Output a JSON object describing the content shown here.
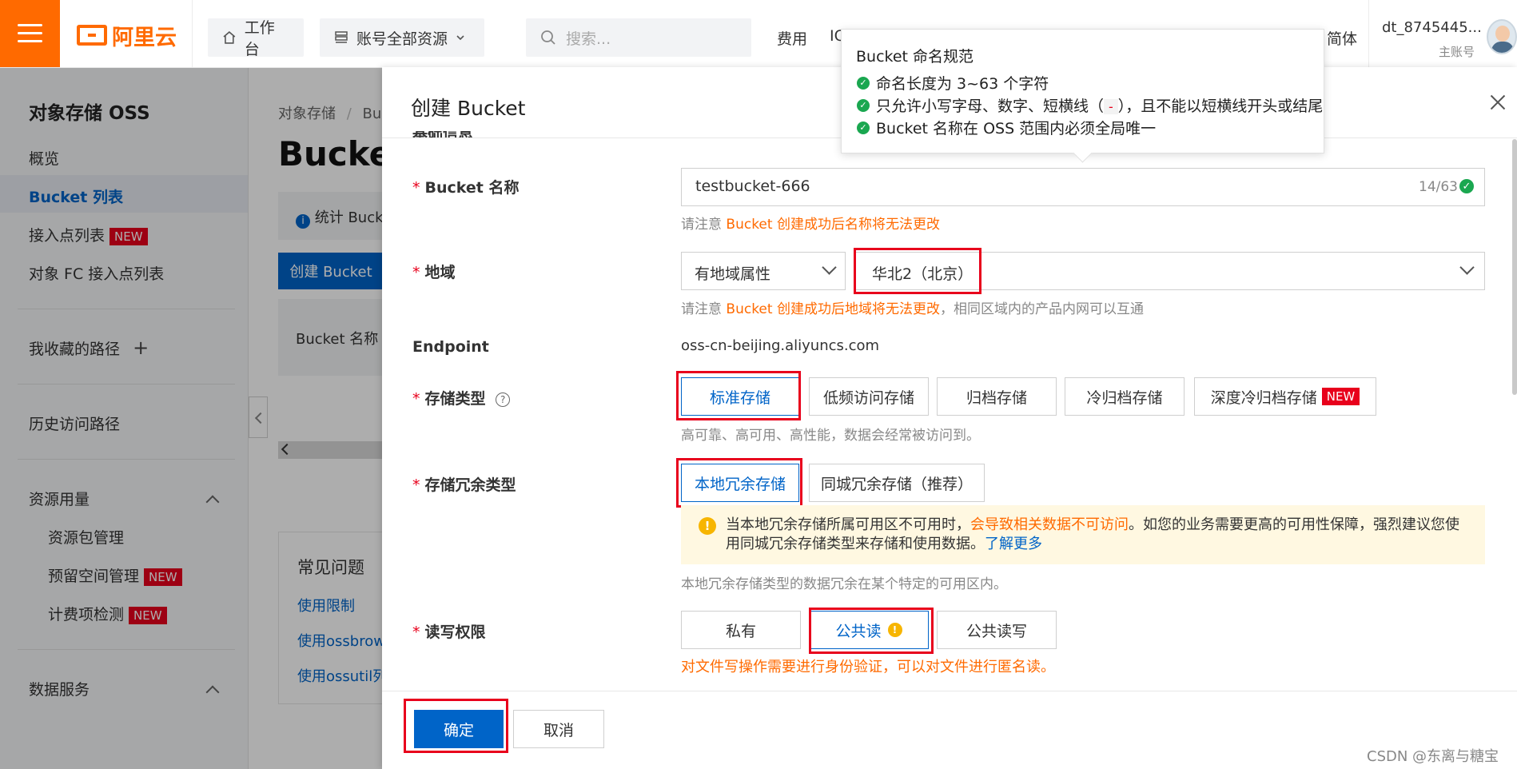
{
  "topbar": {
    "logo_text": "阿里云",
    "workbench": "工作台",
    "resources": "账号全部资源",
    "search_placeholder": "搜索...",
    "link_fee": "费用",
    "link_ic": "IC",
    "link_lang": "简体",
    "user_name": "dt_8745445...",
    "user_sub": "主账号"
  },
  "sidebar": {
    "title": "对象存储 OSS",
    "items": [
      "概览",
      "Bucket 列表",
      "接入点列表",
      "对象 FC 接入点列表",
      "我收藏的路径",
      "历史访问路径",
      "资源用量",
      "资源包管理",
      "预留空间管理",
      "计费项检测",
      "数据服务"
    ],
    "new_badge": "NEW",
    "add_icon": "+"
  },
  "background": {
    "breadcrumb_root": "对象存储",
    "breadcrumb_sep": "/",
    "breadcrumb_current": "Buc",
    "page_title": "Bucket",
    "info_text": "统计 Bucke",
    "create_button": "创建 Bucket",
    "col_bucket_name": "Bucket 名称",
    "faq_title": "常见问题",
    "faq_links": [
      "使用限制",
      "使用ossbrows",
      "使用ossutil列"
    ]
  },
  "drawer": {
    "title": "创建 Bucket",
    "section_partial": "基础信息",
    "labels": {
      "bucket_name": "Bucket 名称",
      "region": "地域",
      "endpoint": "Endpoint",
      "storage_class": "存储类型",
      "redundancy": "存储冗余类型",
      "acl": "读写权限"
    },
    "bucket_name_value": "testbucket-666",
    "bucket_name_counter": "14/63",
    "name_hint_prefix": "请注意",
    "name_hint_orange": "Bucket 创建成功后名称将无法更改",
    "region_attr": "有地域属性",
    "region_value": "华北2（北京）",
    "region_hint_prefix": "请注意",
    "region_hint_orange": "Bucket 创建成功后地域将无法更改",
    "region_hint_suffix": "，相同区域内的产品内网可以互通",
    "endpoint_value": "oss-cn-beijing.aliyuncs.com",
    "storage_options": [
      "标准存储",
      "低频访问存储",
      "归档存储",
      "冷归档存储",
      "深度冷归档存储"
    ],
    "storage_selected": "标准存储",
    "storage_hint": "高可靠、高可用、高性能，数据会经常被访问到。",
    "redundancy_options": [
      "本地冗余存储",
      "同城冗余存储（推荐）"
    ],
    "redundancy_selected": "本地冗余存储",
    "warn_part1": "当本地冗余存储所属可用区不可用时，",
    "warn_orange": "会导致相关数据不可访问",
    "warn_part2": "。如您的业务需要更高的可用性保障，强烈建议您使用同城冗余存储类型来存储和使用数据。",
    "warn_link": "了解更多",
    "redundancy_hint": "本地冗余存储类型的数据冗余在某个特定的可用区内。",
    "acl_options": [
      "私有",
      "公共读",
      "公共读写"
    ],
    "acl_selected": "公共读",
    "acl_warning": "对文件写操作需要进行身份验证，可以对文件进行匿名读。",
    "ok_button": "确定",
    "cancel_button": "取消"
  },
  "tooltip": {
    "title": "Bucket 命名规范",
    "rule1": "命名长度为 3~63 个字符",
    "rule2_a": "只允许小写字母、数字、短横线（",
    "rule2_dash": "-",
    "rule2_b": "），且不能以短横线开头或结尾",
    "rule3": "Bucket 名称在 OSS 范围内必须全局唯一"
  },
  "watermark": "CSDN @东离与糖宝",
  "colors": {
    "brand_orange": "#ff6a00",
    "primary_blue": "#0064c8",
    "highlight_red": "#e8001c",
    "success_green": "#1aa750"
  }
}
